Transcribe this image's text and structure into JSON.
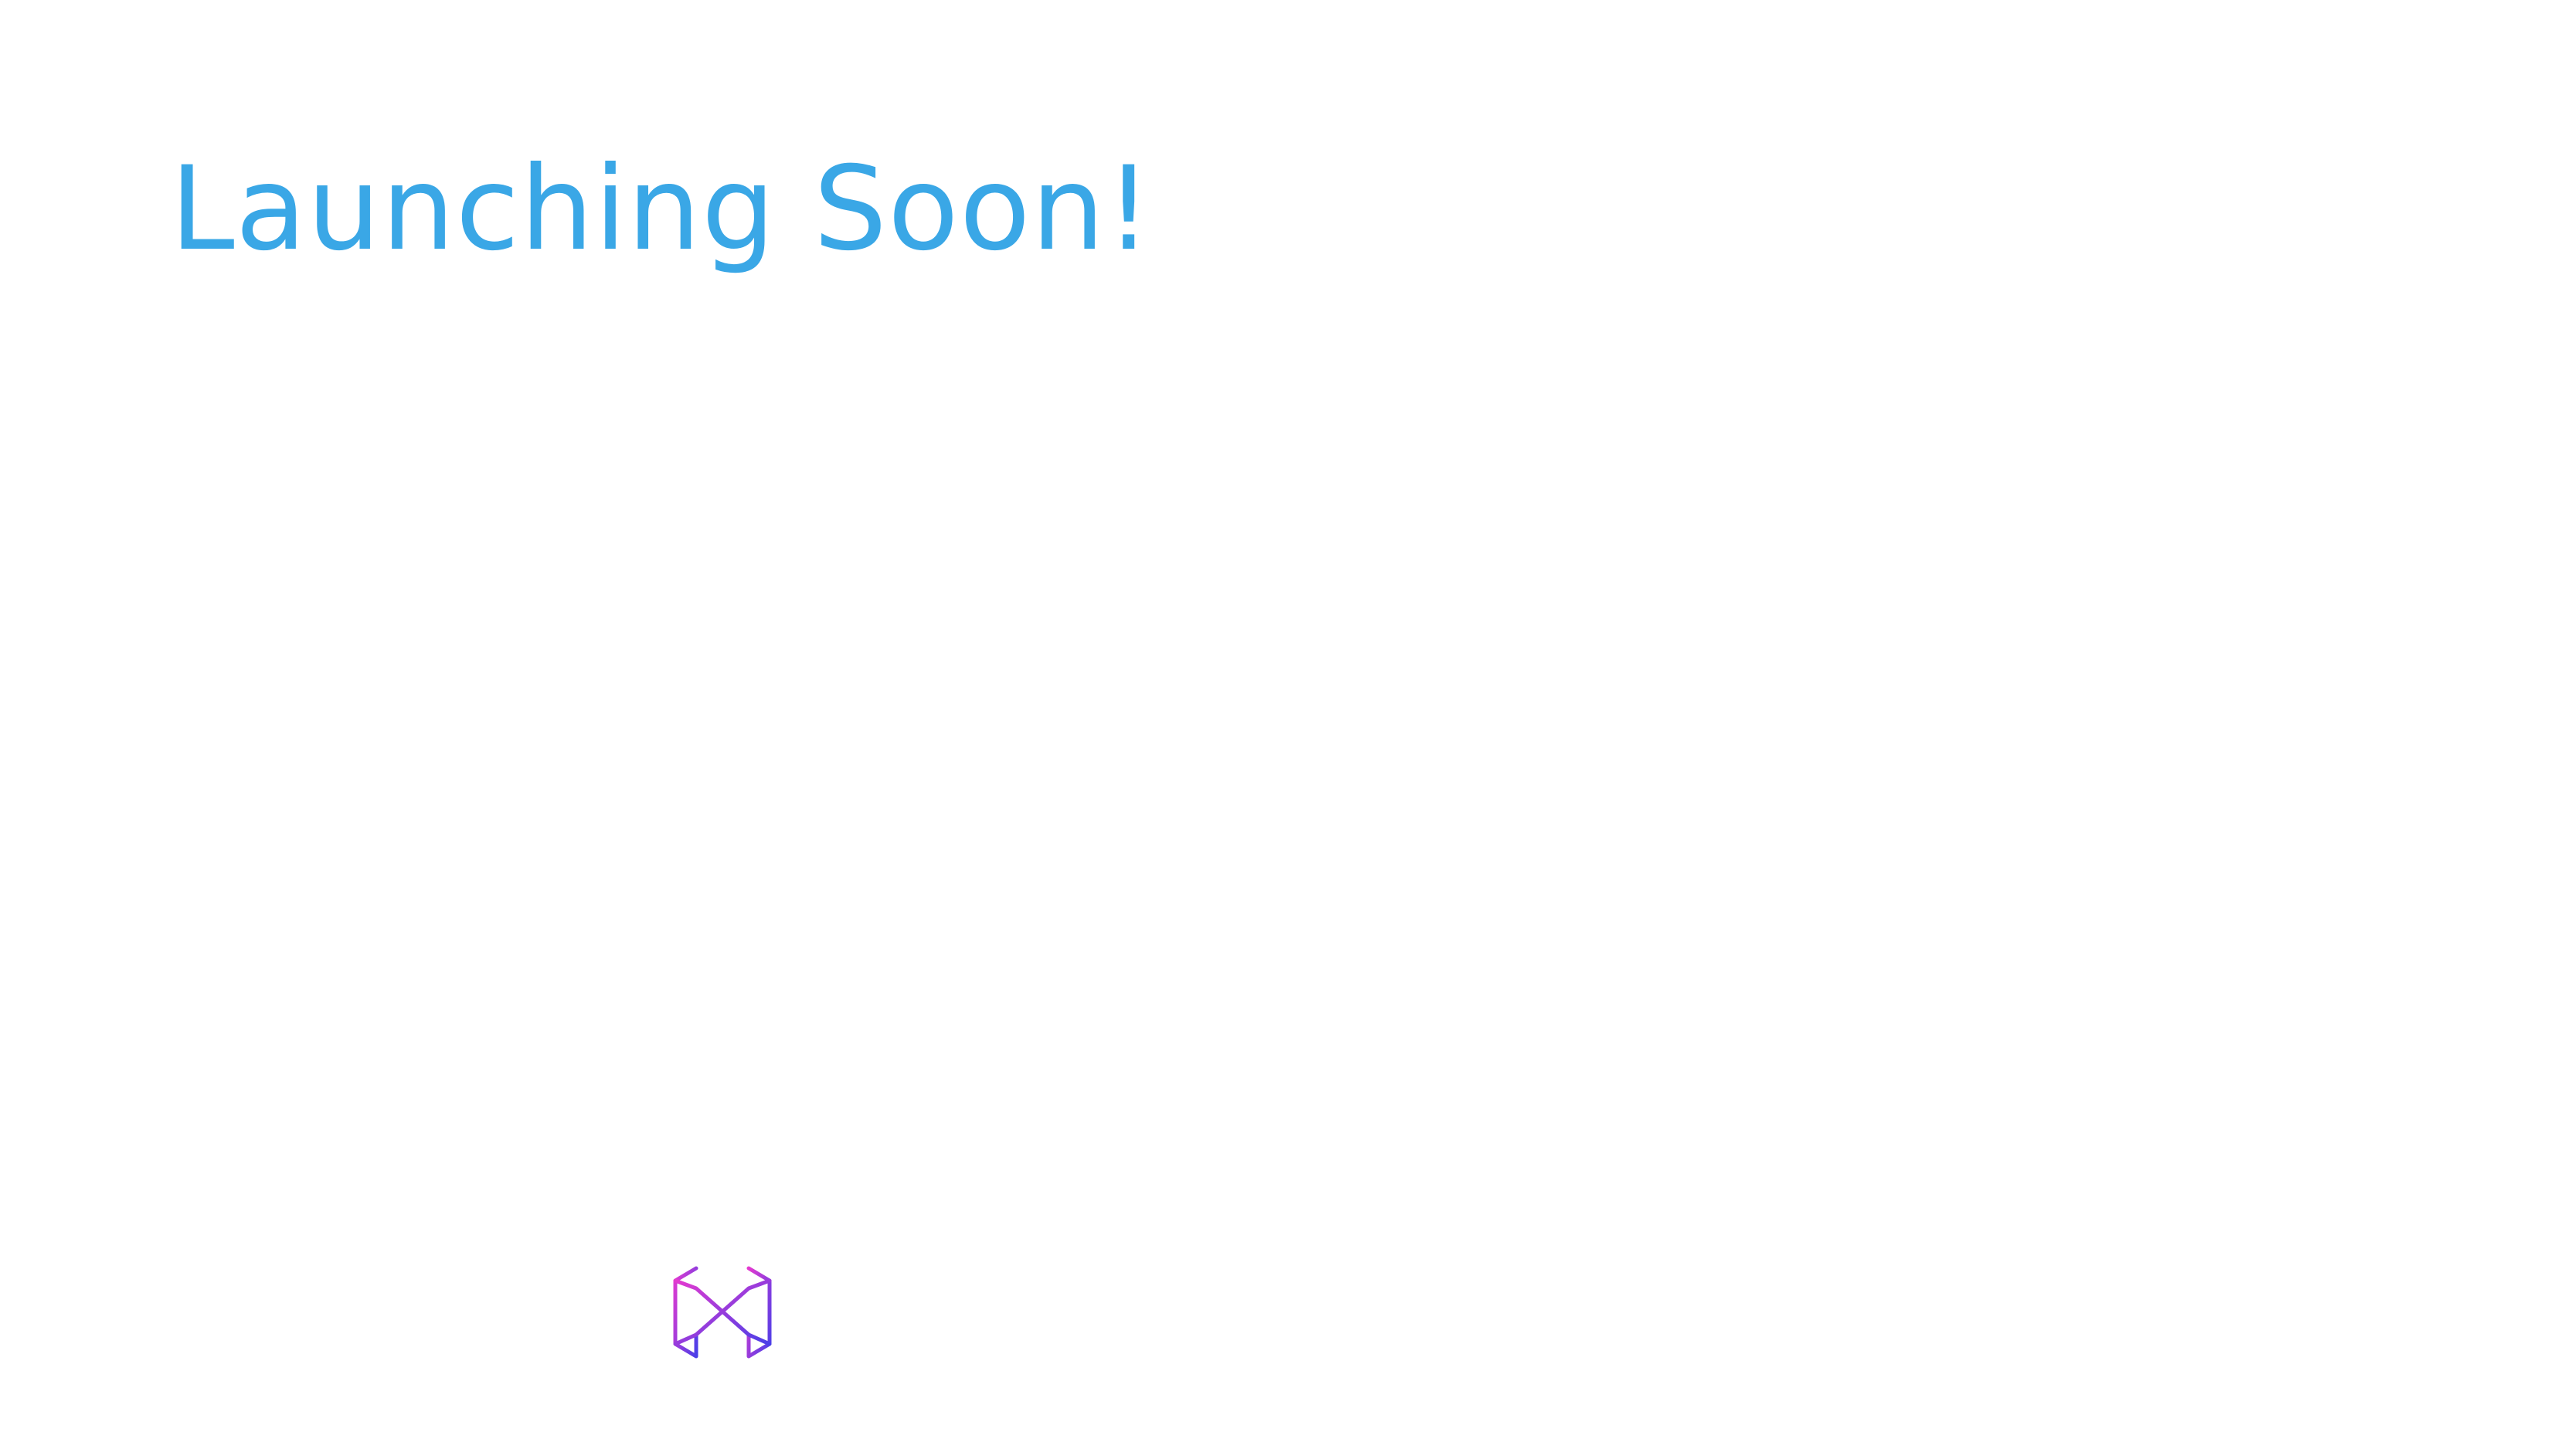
{
  "page": {
    "background_color": "#ffffff"
  },
  "hero": {
    "headline": "Launching Soon!",
    "headline_color": "#3aa7e6"
  },
  "logo": {
    "icon": "hexagon-h-logo-icon",
    "gradient_start": "#e43ad0",
    "gradient_end": "#4a3fe8"
  }
}
